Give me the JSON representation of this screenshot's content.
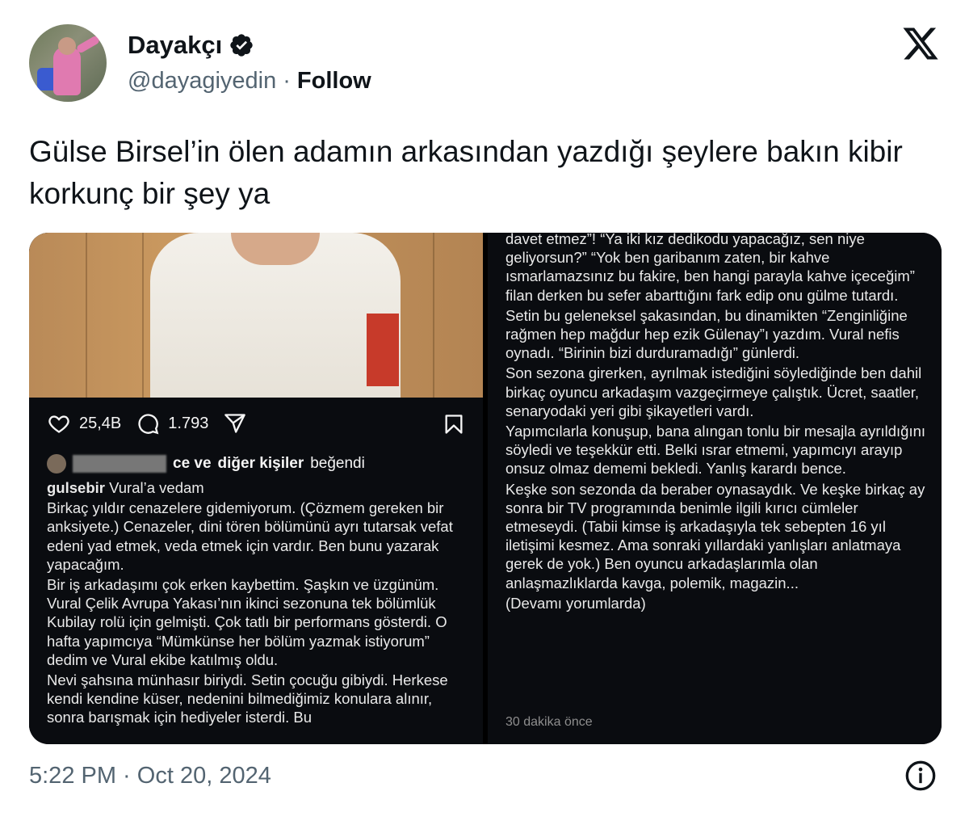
{
  "author": {
    "display_name": "Dayakçı",
    "handle": "@dayagiyedin",
    "separator": "·",
    "follow_label": "Follow",
    "verified": true
  },
  "tweet": {
    "text": "Gülse Birsel’in ölen adamın arkasından yazdığı şeylere bakın kibir korkunç bir şey ya",
    "timestamp": "5:22 PM · Oct 20, 2024"
  },
  "instagram_left": {
    "likes": "25,4B",
    "comments": "1.793",
    "liked_by_suffix": "ce ve",
    "liked_by_others": "diğer kişiler",
    "liked_by_verb": "beğendi",
    "caption_user": "gulsebir",
    "caption_title": "Vural’a vedam",
    "paragraphs": [
      "Birkaç yıldır cenazelere gidemiyorum. (Çözmem gereken bir anksiyete.) Cenazeler, dini tören bölümünü ayrı tutarsak vefat edeni yad etmek, veda etmek için vardır. Ben bunu yazarak yapacağım.",
      "Bir iş arkadaşımı çok erken kaybettim. Şaşkın ve üzgünüm. Vural Çelik Avrupa Yakası’nın ikinci sezonuna tek bölümlük Kubilay rolü için gelmişti. Çok tatlı bir performans gösterdi. O hafta yapımcıya “Mümkünse her bölüm yazmak istiyorum” dedim ve Vural ekibe katılmış oldu.",
      "Nevi şahsına münhasır biriydi. Setin çocuğu gibiydi. Herkese kendi kendine küser, nedenini bilmediğimiz konulara alınır, sonra barışmak için hediyeler isterdi. Bu"
    ]
  },
  "instagram_right": {
    "paragraphs": [
      "davet etmez”! “Ya iki kız dedikodu yapacağız, sen niye geliyorsun?” “Yok ben garibanım zaten, bir kahve ısmarlamazsınız bu fakire, ben hangi parayla kahve içeceğim” filan derken bu sefer abarttığını fark edip onu gülme tutardı.",
      "Setin bu geleneksel şakasından,  bu dinamikten “Zenginliğine rağmen hep mağdur hep ezik Gülenay”ı yazdım. Vural nefis oynadı. “Birinin bizi durduramadığı” günlerdi.",
      "Son sezona girerken, ayrılmak istediğini söylediğinde ben dahil birkaç oyuncu arkadaşım vazgeçirmeye çalıştık. Ücret, saatler, senaryodaki yeri gibi şikayetleri vardı.",
      "Yapımcılarla konuşup, bana alıngan tonlu bir mesajla ayrıldığını söyledi ve teşekkür etti. Belki ısrar etmemi, yapımcıyı arayıp onsuz olmaz dememi bekledi. Yanlış karardı bence.",
      "Keşke son sezonda da beraber oynasaydık. Ve keşke birkaç ay sonra bir TV programında benimle ilgili kırıcı cümleler etmeseydi. (Tabii kimse iş arkadaşıyla tek sebepten 16 yıl iletişimi kesmez. Ama sonraki yıllardaki yanlışları anlatmaya gerek de yok.) Ben oyuncu arkadaşlarımla olan anlaşmazlıklarda kavga, polemik, magazin...",
      "(Devamı yorumlarda)"
    ],
    "time_ago": "30 dakika önce"
  },
  "colors": {
    "verified_badge": "#0f1419",
    "muted": "#536471",
    "ig_background": "#0a0c10"
  },
  "icons": [
    "verified-badge-icon",
    "x-logo-icon",
    "heart-icon",
    "comment-icon",
    "share-icon",
    "bookmark-icon",
    "info-icon"
  ]
}
